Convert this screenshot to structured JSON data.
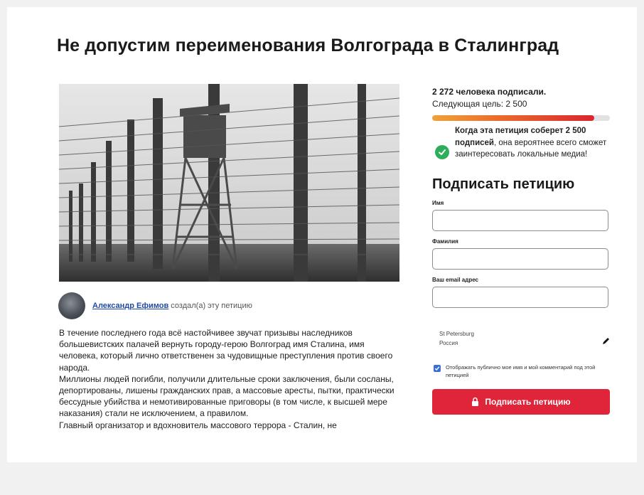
{
  "page": {
    "title": "Не допустим переименования Волгограда в Сталинград"
  },
  "author": {
    "name": "Александр Ефимов",
    "action": " создал(а) эту петицию"
  },
  "story": [
    "В течение последнего года всё настойчивее звучат призывы наследников большевистских палачей вернуть городу-герою Волгоград имя Сталина, имя человека, который лично ответственен за чудовищные преступления против своего народа.",
    "Миллионы людей погибли, получили длительные сроки заключения, были сосланы, депортированы, лишены гражданских прав, а массовые аресты, пытки, практически бессудные убийства и немотивированные приговоры (в том числе, к высшей мере наказания) стали не исключением, а правилом.",
    "Главный организатор и вдохновитель массового террора - Сталин, не"
  ],
  "stats": {
    "signed_text": "2 272 человека подписали.",
    "goal_text": "Следующая цель: 2 500",
    "progress_fraction": 0.91,
    "progress_colors": [
      "#f0a23a",
      "#e9672b",
      "#d9262f"
    ]
  },
  "promo": {
    "lead": "Когда эта петиция соберет",
    "bold": "2 500 подписей",
    "rest": ", она вероятнее всего сможет заинтересовать локальные медиа!",
    "icon": "check-circle-icon"
  },
  "form": {
    "heading": "Подписать петицию",
    "first_name_label": "Имя",
    "last_name_label": "Фамилия",
    "email_label": "Ваш email адрес",
    "first_name_value": "",
    "last_name_value": "",
    "email_value": "",
    "location_city": "St Petersburg",
    "location_country": "Россия",
    "consent_text": "Отображать публично мое имя и мой комментарий под этой петицией",
    "consent_checked": true,
    "button_label": "Подписать петицию",
    "button_color": "#e0243a"
  }
}
